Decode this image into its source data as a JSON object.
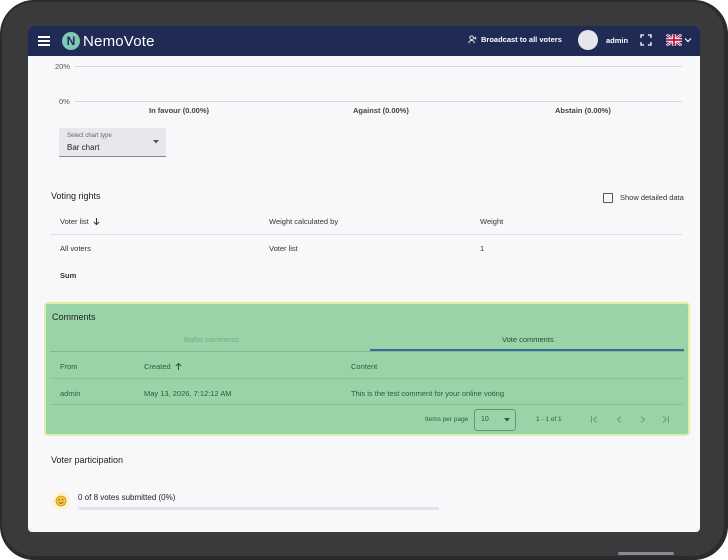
{
  "app": {
    "title": "NemoVote",
    "logo_letter": "N"
  },
  "header": {
    "broadcast_label": "Broadcast to all voters",
    "user_name": "admin"
  },
  "chart": {
    "ticks": [
      "20%",
      "0%"
    ],
    "categories": [
      "In favour (0.00%)",
      "Against (0.00%)",
      "Abstain (0.00%)"
    ],
    "select_label": "Select chart type",
    "select_value": "Bar chart"
  },
  "voting_rights": {
    "title": "Voting rights",
    "show_detailed_label": "Show detailed data",
    "columns": [
      "Voter list",
      "Weight calculated by",
      "Weight"
    ],
    "rows": [
      [
        "All voters",
        "Voter list",
        "1"
      ]
    ],
    "sum_label": "Sum"
  },
  "comments": {
    "title": "Comments",
    "tabs": [
      "Ballot comments",
      "Vote comments"
    ],
    "active_tab": 1,
    "columns": [
      "From",
      "Created",
      "Content"
    ],
    "rows": [
      [
        "admin",
        "May 13, 2026, 7:12:12 AM",
        "This is the test comment for your online voting"
      ]
    ],
    "items_per_page_label": "Items per page",
    "items_per_page_value": "10",
    "range_label": "1 - 1 of 1"
  },
  "participation": {
    "title": "Voter participation",
    "summary": "0 of 8 votes submitted (0%)",
    "progress": 0
  },
  "colors": {
    "topbar": "#1f2a55",
    "comments_bg": "#98d4a7",
    "comments_border": "#d9f2a3",
    "tab_indicator": "#3a6aa0"
  }
}
